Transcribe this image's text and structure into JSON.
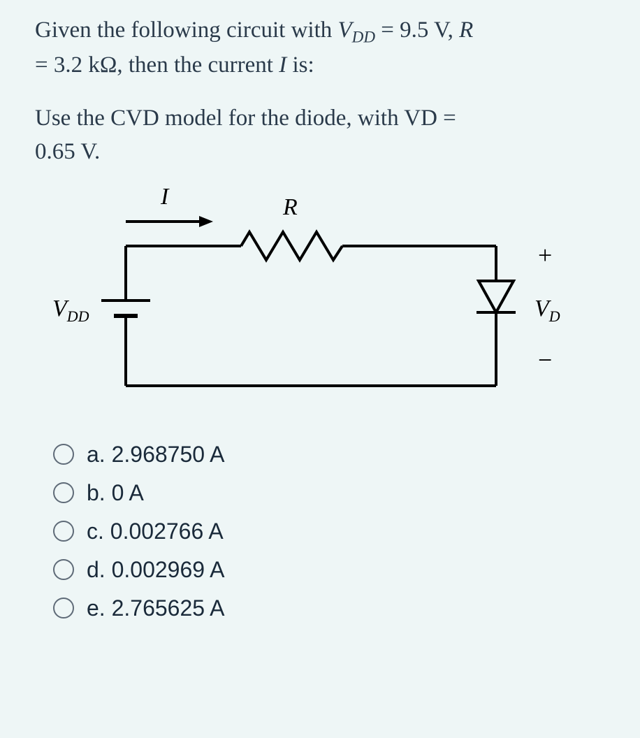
{
  "question": {
    "line1_prefix": "Given the following circuit with ",
    "vdd_sym": "V",
    "vdd_sub": "DD",
    "vdd_eq": " = 9.5 V, ",
    "r_sym": "R",
    "line2_prefix": "= 3.2 kΩ, then the current ",
    "i_sym": "I ",
    "line2_suffix": "is:"
  },
  "hint": {
    "prefix": "Use the CVD model for the diode, with ",
    "vd_sym": "V",
    "vd_sub": "D",
    "vd_eq": " = ",
    "line2": "0.65 V."
  },
  "circuit": {
    "i_label": "I",
    "r_label": "R",
    "vdd_sym": "V",
    "vdd_sub": "DD",
    "vd_sym": "V",
    "vd_sub": "D",
    "plus": "+",
    "minus": "−"
  },
  "options": [
    {
      "label": "a. 2.968750 A"
    },
    {
      "label": "b. 0 A"
    },
    {
      "label": "c. 0.002766 A"
    },
    {
      "label": "d. 0.002969 A"
    },
    {
      "label": "e. 2.765625 A"
    }
  ]
}
